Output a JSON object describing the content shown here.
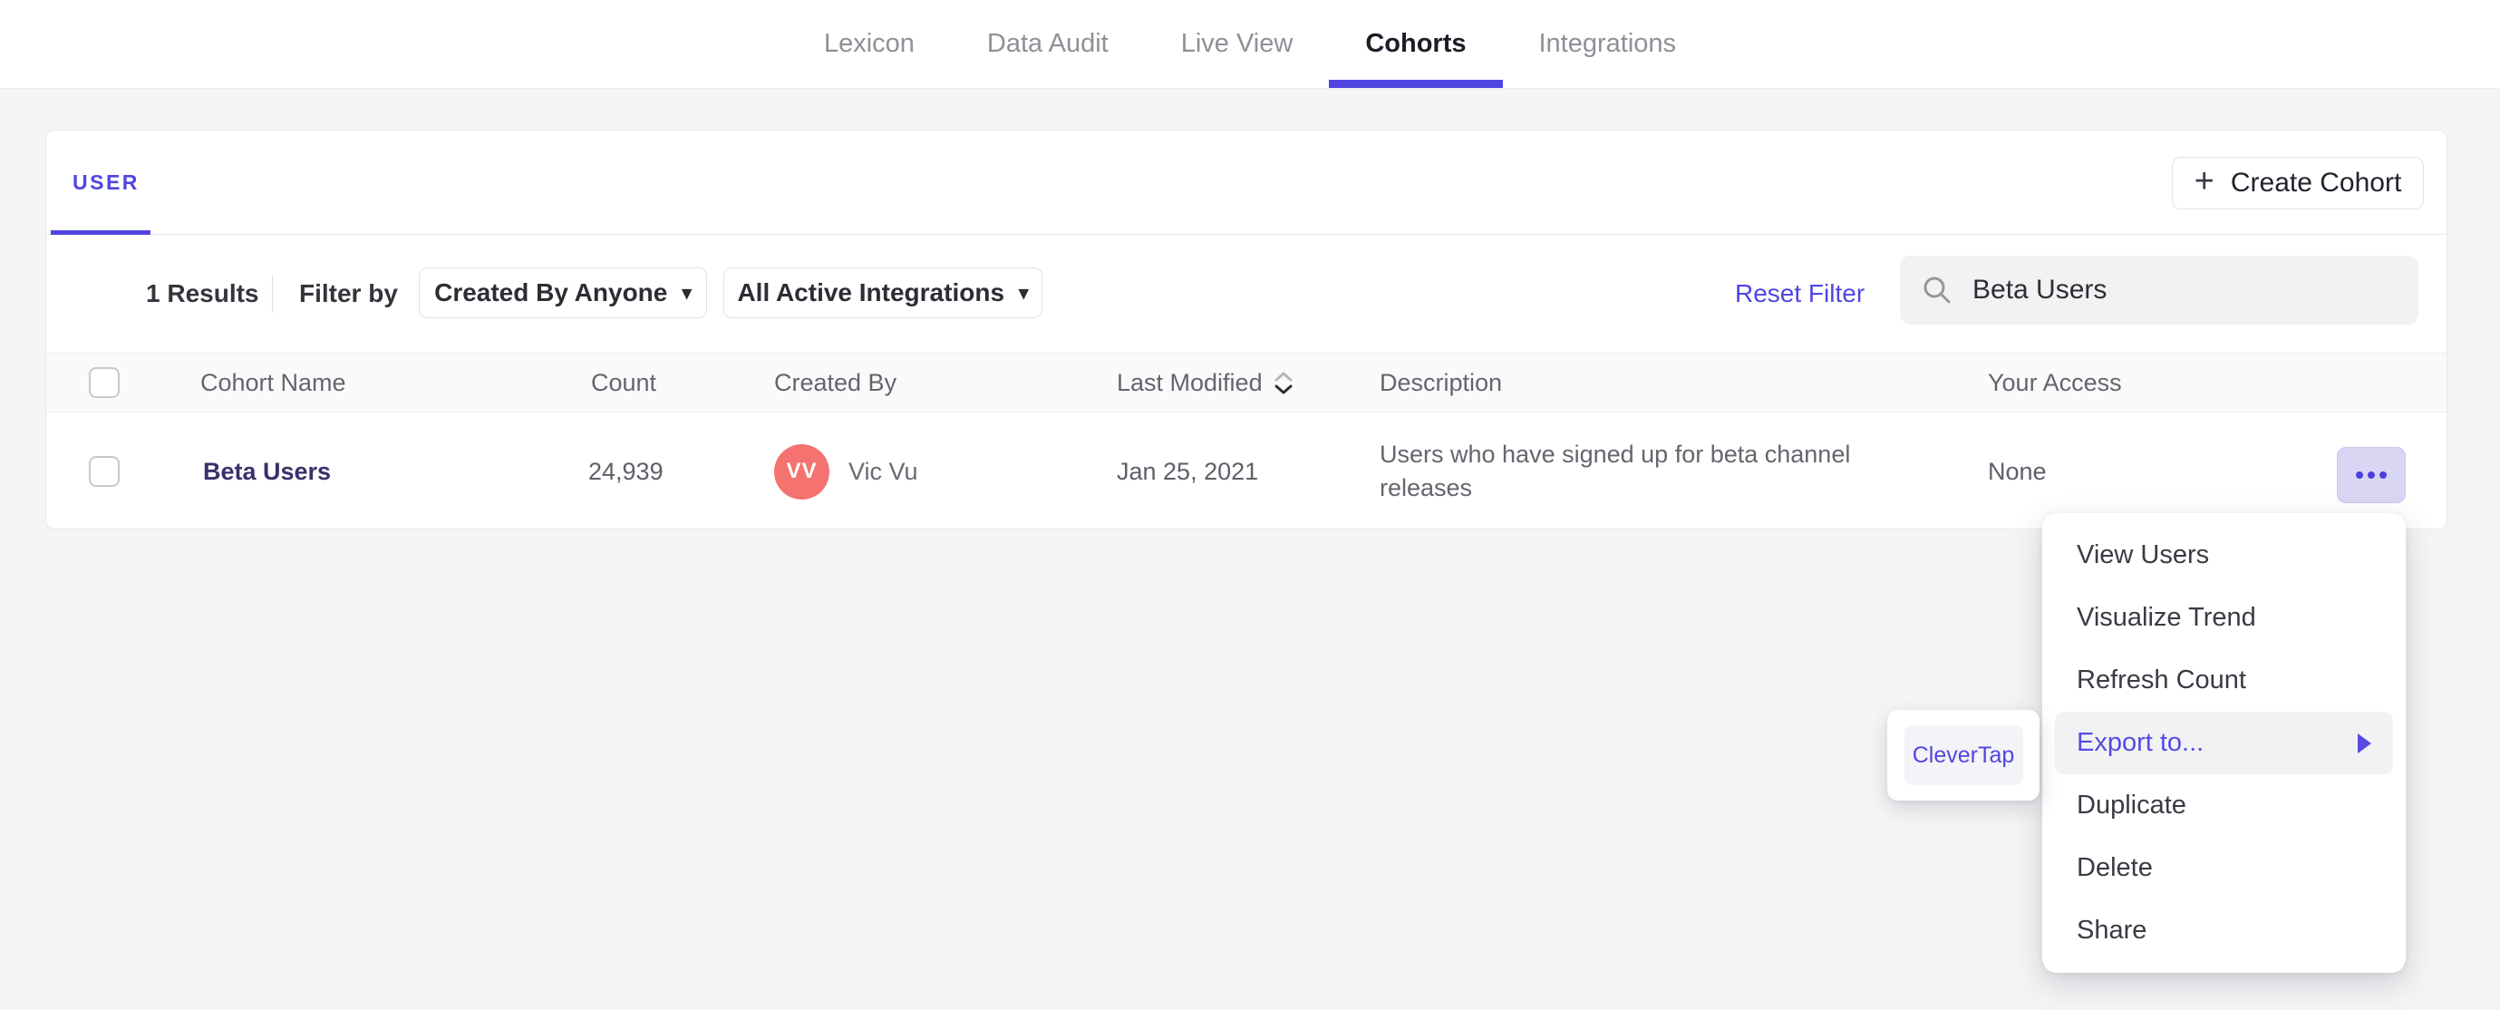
{
  "nav": {
    "items": [
      {
        "label": "Lexicon"
      },
      {
        "label": "Data Audit"
      },
      {
        "label": "Live View"
      },
      {
        "label": "Cohorts"
      },
      {
        "label": "Integrations"
      }
    ],
    "active": "Cohorts"
  },
  "tabs": {
    "user_label": "USER",
    "create_button_label": "Create Cohort",
    "plus_glyph": "+"
  },
  "filter_bar": {
    "results_count": "1 Results",
    "filter_by_label": "Filter by",
    "created_by_value": "Created By Anyone",
    "integrations_value": "All Active Integrations",
    "caret_glyph": "▾",
    "reset_label": "Reset Filter",
    "search_value": "Beta Users",
    "search_icon": "magnifier"
  },
  "table": {
    "headers": {
      "name": "Cohort Name",
      "count": "Count",
      "created_by": "Created By",
      "last_modified": "Last Modified",
      "description": "Description",
      "your_access": "Your Access"
    },
    "sort": {
      "column": "Last Modified",
      "direction": "desc"
    },
    "row": {
      "name": "Beta Users",
      "count": "24,939",
      "avatar_initials": "VV",
      "created_by": "Vic Vu",
      "last_modified": "Jan 25, 2021",
      "description": "Users who have signed up for beta channel releases",
      "your_access": "None"
    }
  },
  "context_menu": {
    "items": [
      {
        "label": "View Users",
        "active": false
      },
      {
        "label": "Visualize Trend",
        "active": false
      },
      {
        "label": "Refresh Count",
        "active": false
      },
      {
        "label": "Export to...",
        "active": true,
        "has_submenu": true
      },
      {
        "label": "Duplicate",
        "active": false
      },
      {
        "label": "Delete",
        "active": false
      },
      {
        "label": "Share",
        "active": false
      }
    ]
  },
  "submenu": {
    "items": [
      {
        "label": "CleverTap"
      }
    ]
  },
  "colors": {
    "accent_purple": "#5145e1",
    "link_purple": "#4f44e6",
    "cohort_link_indigo": "#37326b",
    "avatar_salmon": "#f4726f",
    "more_button_bg": "#d9d6f4",
    "menu_highlight_bg": "#f2f2f5",
    "page_bg": "#f5f5f6",
    "header_row_bg": "#fafafb"
  }
}
